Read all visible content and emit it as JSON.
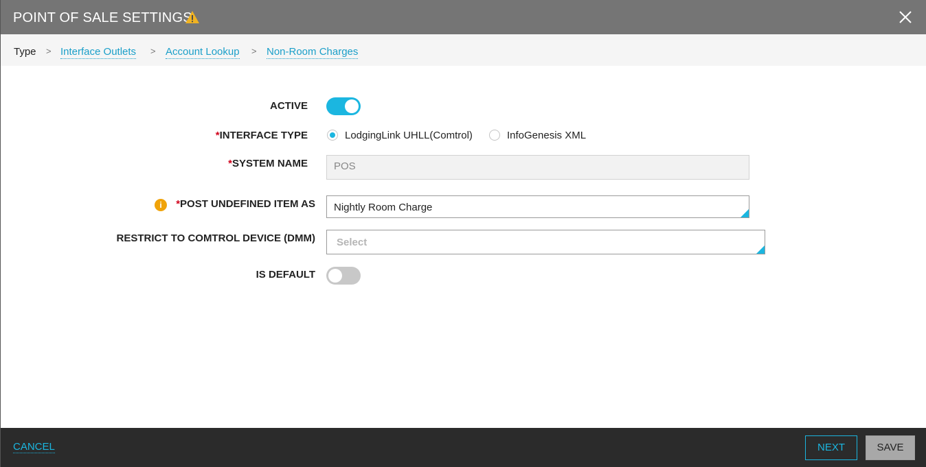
{
  "header": {
    "title": "POINT OF SALE SETTINGS",
    "warning_icon": "warning-triangle-icon",
    "close_icon": "close-icon"
  },
  "breadcrumb": {
    "items": [
      {
        "label": "Type",
        "link": false
      },
      {
        "label": "Interface Outlets",
        "link": true
      },
      {
        "label": "Account Lookup",
        "link": true
      },
      {
        "label": "Non-Room Charges",
        "link": true
      }
    ],
    "separator": ">"
  },
  "form": {
    "active": {
      "label": "ACTIVE",
      "value": true
    },
    "interface_type": {
      "required_mark": "*",
      "label": "INTERFACE TYPE",
      "options": [
        "LodgingLink UHLL(Comtrol)",
        "InfoGenesis XML"
      ],
      "selected": "LodgingLink UHLL(Comtrol)"
    },
    "system_name": {
      "required_mark": "*",
      "label": "SYSTEM NAME",
      "value": "POS"
    },
    "post_undefined": {
      "required_mark": "*",
      "label": "POST UNDEFINED ITEM AS",
      "value": "Nightly Room Charge",
      "info_icon": "info-icon"
    },
    "restrict_device": {
      "label": "RESTRICT TO COMTROL DEVICE (DMM)",
      "placeholder": "Select"
    },
    "is_default": {
      "label": "IS DEFAULT",
      "value": false
    }
  },
  "footer": {
    "cancel_label": "CANCEL",
    "next_label": "NEXT",
    "save_label": "SAVE"
  },
  "colors": {
    "accent": "#1bb6e0",
    "titlebar": "#757575",
    "footer": "#2b2b2b",
    "required": "#d0021b",
    "warning": "#f0a30a"
  }
}
